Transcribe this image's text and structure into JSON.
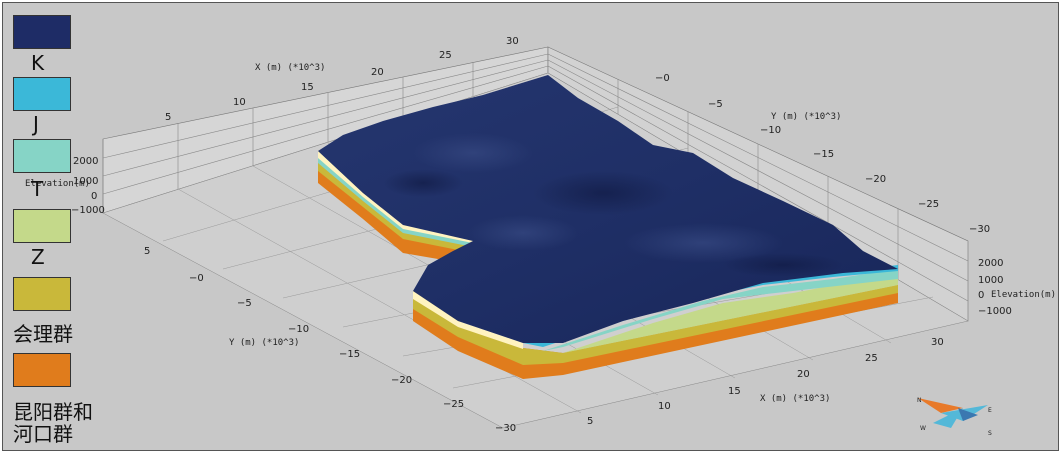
{
  "legend": {
    "items": [
      {
        "label": "K",
        "color": "#1e2c66"
      },
      {
        "label": "J",
        "color": "#3bb8d8"
      },
      {
        "label": "T",
        "color": "#86d4c6"
      },
      {
        "label": "Z",
        "color": "#c4d98a"
      },
      {
        "label": "会理群",
        "color": "#c9b83a"
      },
      {
        "label": "昆阳群和\n河口群",
        "color": "#e07c1c"
      }
    ]
  },
  "axes": {
    "x_title_top": "X (m) (*10^3)",
    "x_title_bottom": "X (m) (*10^3)",
    "y_title_right": "Y (m) (*10^3)",
    "y_title_left": "Y (m) (*10^3)",
    "elev_title_left": "Elevation(m)",
    "elev_title_right": "Elevation(m)",
    "x_ticks_top": [
      "5",
      "10",
      "15",
      "20",
      "25",
      "30"
    ],
    "x_ticks_bottom": [
      "5",
      "10",
      "15",
      "20",
      "25",
      "30"
    ],
    "y_ticks_right": [
      "−0",
      "−5",
      "−10",
      "−15",
      "−20",
      "−25",
      "−30"
    ],
    "y_ticks_left": [
      "5",
      "−0",
      "−5",
      "−10",
      "−15",
      "−20",
      "−25",
      "−30"
    ],
    "elev_ticks_left": [
      "2000",
      "1000",
      "0",
      "−1000"
    ],
    "elev_ticks_right": [
      "2000",
      "1000",
      "0",
      "−1000"
    ]
  },
  "compass": {
    "labels": [
      "N",
      "E",
      "S",
      "W"
    ]
  }
}
